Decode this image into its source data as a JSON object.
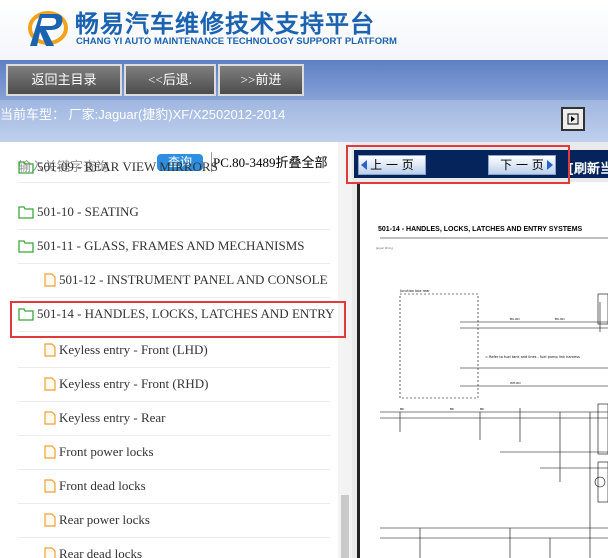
{
  "header": {
    "title": "畅易汽车维修技术支持平台",
    "subtitle": "CHANG YI AUTO MAINTENANCE TECHNOLOGY SUPPORT PLATFORM"
  },
  "nav": {
    "home": "返回主目录",
    "back": "<<后退.",
    "forward": ">>前进"
  },
  "car": {
    "model": "当前车型： 厂家:Jaguar(捷豹)XF/X2502012-2014"
  },
  "search": {
    "placeholder": "输入关键字查询",
    "button": "查询",
    "pc_info": "PC.80-3489折叠全部"
  },
  "tree": {
    "items": [
      {
        "label": "501-09 - REAR VIEW MIRRORS",
        "type": "folder"
      },
      {
        "label": "501-10 - SEATING",
        "type": "folder"
      },
      {
        "label": "501-11 - GLASS, FRAMES AND MECHANISMS",
        "type": "folder"
      },
      {
        "label": "501-12 - INSTRUMENT PANEL AND CONSOLE",
        "type": "file"
      },
      {
        "label": "501-14 - HANDLES, LOCKS, LATCHES AND ENTRY",
        "type": "folder"
      },
      {
        "label": "Keyless entry - Front (LHD)",
        "type": "file"
      },
      {
        "label": "Keyless entry - Front (RHD)",
        "type": "file"
      },
      {
        "label": "Keyless entry - Rear",
        "type": "file"
      },
      {
        "label": "Front power locks",
        "type": "file"
      },
      {
        "label": "Front dead locks",
        "type": "file"
      },
      {
        "label": "Rear power locks",
        "type": "file"
      },
      {
        "label": "Rear dead locks",
        "type": "file"
      }
    ]
  },
  "pager": {
    "prev": "上 一 页",
    "next": "下 一 页",
    "refresh": "[刷新当"
  },
  "document": {
    "title": "501-14 - HANDLES, LOCKS, LATCHES AND ENTRY SYSTEMS",
    "note": "= Refer to fuel tank and lines - fuel pump link harness"
  },
  "colors": {
    "nav_bg": "#6f8ecb",
    "highlight": "#e03a3a",
    "brand": "#1b62b0"
  }
}
